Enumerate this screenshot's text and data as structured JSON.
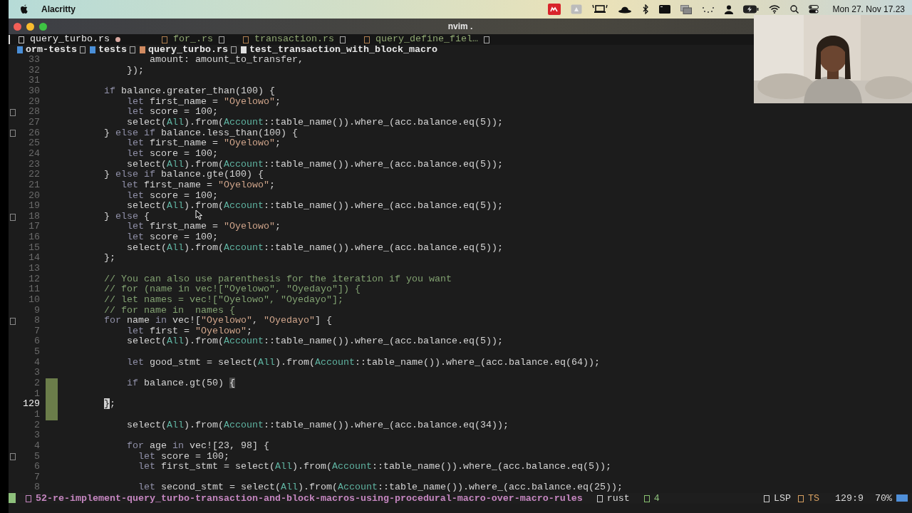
{
  "menu_bar": {
    "app": "Alacritty",
    "clock": "Mon 27. Nov  17.23"
  },
  "window": {
    "title": "nvim ."
  },
  "tabs": [
    {
      "label": "query_turbo.rs",
      "selected": true,
      "modified": true
    },
    {
      "label": "for_.rs",
      "selected": false,
      "modified": false
    },
    {
      "label": "transaction.rs",
      "selected": false,
      "modified": false
    },
    {
      "label": "query_define_fiel…",
      "selected": false,
      "modified": false
    }
  ],
  "breadcrumb": [
    {
      "label": "orm-tests",
      "color": "#4a8fd8"
    },
    {
      "label": "tests",
      "color": "#4a8fd8"
    },
    {
      "label": "query_turbo.rs",
      "color": "#d08a60"
    },
    {
      "label": "test_transaction_with_block_macro",
      "color": "#e0e0e0"
    }
  ],
  "lines": [
    {
      "number": "33",
      "current": false,
      "sign": false,
      "changed": false,
      "segments": [
        {
          "text": "                amount: amount_to_transfer,",
          "kind": "plain"
        }
      ]
    },
    {
      "number": "32",
      "current": false,
      "sign": false,
      "changed": false,
      "segments": [
        {
          "text": "            });",
          "kind": "plain"
        }
      ]
    },
    {
      "number": "31",
      "current": false,
      "sign": false,
      "changed": false
    },
    {
      "number": "30",
      "current": false,
      "sign": false,
      "changed": false,
      "segments": [
        {
          "text": "        if",
          "kind": "kw"
        },
        {
          "text": " balance.greater_than(100) {",
          "kind": "plain"
        }
      ]
    },
    {
      "number": "29",
      "current": false,
      "sign": false,
      "changed": false,
      "segments": [
        {
          "text": "            let",
          "kind": "kw"
        },
        {
          "text": " first_name = ",
          "kind": "plain"
        },
        {
          "text": "\"Oyelowo\"",
          "kind": "str"
        },
        {
          "text": ";",
          "kind": "plain"
        }
      ]
    },
    {
      "number": "28",
      "current": false,
      "sign": true,
      "changed": false,
      "segments": [
        {
          "text": "            let",
          "kind": "kw"
        },
        {
          "text": " score = 100;",
          "kind": "plain"
        }
      ]
    },
    {
      "number": "27",
      "current": false,
      "sign": false,
      "changed": false,
      "segments": [
        {
          "text": "            select(",
          "kind": "plain"
        },
        {
          "text": "All",
          "kind": "type"
        },
        {
          "text": ").from(",
          "kind": "plain"
        },
        {
          "text": "Account",
          "kind": "type"
        },
        {
          "text": "::table_name()).where_(acc.balance.eq(5));",
          "kind": "plain"
        }
      ]
    },
    {
      "number": "26",
      "current": false,
      "sign": true,
      "changed": false,
      "segments": [
        {
          "text": "        } ",
          "kind": "plain"
        },
        {
          "text": "else if",
          "kind": "kw"
        },
        {
          "text": " balance.less_than(100) {",
          "kind": "plain"
        }
      ]
    },
    {
      "number": "25",
      "current": false,
      "sign": false,
      "changed": false,
      "segments": [
        {
          "text": "            let",
          "kind": "kw"
        },
        {
          "text": " first_name = ",
          "kind": "plain"
        },
        {
          "text": "\"Oyelowo\"",
          "kind": "str"
        },
        {
          "text": ";",
          "kind": "plain"
        }
      ]
    },
    {
      "number": "24",
      "current": false,
      "sign": false,
      "changed": false,
      "segments": [
        {
          "text": "            let",
          "kind": "kw"
        },
        {
          "text": " score = 100;",
          "kind": "plain"
        }
      ]
    },
    {
      "number": "23",
      "current": false,
      "sign": false,
      "changed": false,
      "segments": [
        {
          "text": "            select(",
          "kind": "plain"
        },
        {
          "text": "All",
          "kind": "type"
        },
        {
          "text": ").from(",
          "kind": "plain"
        },
        {
          "text": "Account",
          "kind": "type"
        },
        {
          "text": "::table_name()).where_(acc.balance.eq(5));",
          "kind": "plain"
        }
      ]
    },
    {
      "number": "22",
      "current": false,
      "sign": false,
      "changed": false,
      "segments": [
        {
          "text": "        } ",
          "kind": "plain"
        },
        {
          "text": "else if",
          "kind": "kw"
        },
        {
          "text": " balance.gte(100) {",
          "kind": "plain"
        }
      ]
    },
    {
      "number": "21",
      "current": false,
      "sign": false,
      "changed": false,
      "segments": [
        {
          "text": "           let",
          "kind": "kw"
        },
        {
          "text": " first_name = ",
          "kind": "plain"
        },
        {
          "text": "\"Oyelowo\"",
          "kind": "str"
        },
        {
          "text": ";",
          "kind": "plain"
        }
      ]
    },
    {
      "number": "20",
      "current": false,
      "sign": false,
      "changed": false,
      "segments": [
        {
          "text": "            let",
          "kind": "kw"
        },
        {
          "text": " score = 100;",
          "kind": "plain"
        }
      ]
    },
    {
      "number": "19",
      "current": false,
      "sign": false,
      "changed": false,
      "segments": [
        {
          "text": "            select(",
          "kind": "plain"
        },
        {
          "text": "All",
          "kind": "type"
        },
        {
          "text": ").from(",
          "kind": "plain"
        },
        {
          "text": "Account",
          "kind": "type"
        },
        {
          "text": "::table_name()).where_(acc.balance.eq(5));",
          "kind": "plain"
        }
      ]
    },
    {
      "number": "18",
      "current": false,
      "sign": true,
      "changed": false,
      "segments": [
        {
          "text": "        } ",
          "kind": "plain"
        },
        {
          "text": "else",
          "kind": "kw"
        },
        {
          "text": " {",
          "kind": "plain"
        }
      ]
    },
    {
      "number": "17",
      "current": false,
      "sign": false,
      "changed": false,
      "segments": [
        {
          "text": "            let",
          "kind": "kw"
        },
        {
          "text": " first_name = ",
          "kind": "plain"
        },
        {
          "text": "\"Oyelowo\"",
          "kind": "str"
        },
        {
          "text": ";",
          "kind": "plain"
        }
      ]
    },
    {
      "number": "16",
      "current": false,
      "sign": false,
      "changed": false,
      "segments": [
        {
          "text": "            let",
          "kind": "kw"
        },
        {
          "text": " score = 100;",
          "kind": "plain"
        }
      ]
    },
    {
      "number": "15",
      "current": false,
      "sign": false,
      "changed": false,
      "segments": [
        {
          "text": "            select(",
          "kind": "plain"
        },
        {
          "text": "All",
          "kind": "type"
        },
        {
          "text": ").from(",
          "kind": "plain"
        },
        {
          "text": "Account",
          "kind": "type"
        },
        {
          "text": "::table_name()).where_(acc.balance.eq(5));",
          "kind": "plain"
        }
      ]
    },
    {
      "number": "14",
      "current": false,
      "sign": false,
      "changed": false,
      "segments": [
        {
          "text": "        };",
          "kind": "plain"
        }
      ]
    },
    {
      "number": "13",
      "current": false,
      "sign": false,
      "changed": false
    },
    {
      "number": "12",
      "current": false,
      "sign": false,
      "changed": false,
      "segments": [
        {
          "text": "        // You can also use parenthesis for the iteration if you want",
          "kind": "comment"
        }
      ]
    },
    {
      "number": "11",
      "current": false,
      "sign": false,
      "changed": false,
      "segments": [
        {
          "text": "        // for (name in vec![\"Oyelowo\", \"Oyedayo\"]) {",
          "kind": "comment"
        }
      ]
    },
    {
      "number": "10",
      "current": false,
      "sign": false,
      "changed": false,
      "segments": [
        {
          "text": "        // let names = vec![\"Oyelowo\", \"Oyedayo\"];",
          "kind": "comment"
        }
      ]
    },
    {
      "number": "9",
      "current": false,
      "sign": false,
      "changed": false,
      "segments": [
        {
          "text": "        // for name in  names {",
          "kind": "comment"
        }
      ]
    },
    {
      "number": "8",
      "current": false,
      "sign": true,
      "changed": false,
      "segments": [
        {
          "text": "        for",
          "kind": "kw"
        },
        {
          "text": " name ",
          "kind": "plain"
        },
        {
          "text": "in",
          "kind": "kw"
        },
        {
          "text": " vec![",
          "kind": "plain"
        },
        {
          "text": "\"Oyelowo\"",
          "kind": "str"
        },
        {
          "text": ", ",
          "kind": "plain"
        },
        {
          "text": "\"Oyedayo\"",
          "kind": "str"
        },
        {
          "text": "] {",
          "kind": "plain"
        }
      ]
    },
    {
      "number": "7",
      "current": false,
      "sign": false,
      "changed": false,
      "segments": [
        {
          "text": "            let",
          "kind": "kw"
        },
        {
          "text": " first = ",
          "kind": "plain"
        },
        {
          "text": "\"Oyelowo\"",
          "kind": "str"
        },
        {
          "text": ";",
          "kind": "plain"
        }
      ]
    },
    {
      "number": "6",
      "current": false,
      "sign": false,
      "changed": false,
      "segments": [
        {
          "text": "            select(",
          "kind": "plain"
        },
        {
          "text": "All",
          "kind": "type"
        },
        {
          "text": ").from(",
          "kind": "plain"
        },
        {
          "text": "Account",
          "kind": "type"
        },
        {
          "text": "::table_name()).where_(acc.balance.eq(5));",
          "kind": "plain"
        }
      ]
    },
    {
      "number": "5",
      "current": false,
      "sign": false,
      "changed": false
    },
    {
      "number": "4",
      "current": false,
      "sign": false,
      "changed": false,
      "segments": [
        {
          "text": "            let",
          "kind": "kw"
        },
        {
          "text": " good_stmt = select(",
          "kind": "plain"
        },
        {
          "text": "All",
          "kind": "type"
        },
        {
          "text": ").from(",
          "kind": "plain"
        },
        {
          "text": "Account",
          "kind": "type"
        },
        {
          "text": "::table_name()).where_(acc.balance.eq(64));",
          "kind": "plain"
        }
      ]
    },
    {
      "number": "3",
      "current": false,
      "sign": false,
      "changed": false
    },
    {
      "number": "2",
      "current": false,
      "sign": false,
      "changed": true,
      "segments": [
        {
          "text": "            if",
          "kind": "kw"
        },
        {
          "text": " balance.gt(50) ",
          "kind": "plain"
        },
        {
          "text": "{",
          "kind": "match"
        }
      ]
    },
    {
      "number": "1",
      "current": false,
      "sign": false,
      "changed": true
    },
    {
      "number": "129",
      "current": true,
      "sign": false,
      "changed": true,
      "segments": [
        {
          "text": "        }",
          "kind": "cursor"
        },
        {
          "text": ";",
          "kind": "plain"
        }
      ]
    },
    {
      "number": "1",
      "current": false,
      "sign": false,
      "changed": true
    },
    {
      "number": "2",
      "current": false,
      "sign": false,
      "changed": false,
      "segments": [
        {
          "text": "            select(",
          "kind": "plain"
        },
        {
          "text": "All",
          "kind": "type"
        },
        {
          "text": ").from(",
          "kind": "plain"
        },
        {
          "text": "Account",
          "kind": "type"
        },
        {
          "text": "::table_name()).where_(acc.balance.eq(34));",
          "kind": "plain"
        }
      ]
    },
    {
      "number": "3",
      "current": false,
      "sign": false,
      "changed": false
    },
    {
      "number": "4",
      "current": false,
      "sign": false,
      "changed": false,
      "segments": [
        {
          "text": "            for",
          "kind": "kw"
        },
        {
          "text": " age ",
          "kind": "plain"
        },
        {
          "text": "in",
          "kind": "kw"
        },
        {
          "text": " vec![23, 98] {",
          "kind": "plain"
        }
      ]
    },
    {
      "number": "5",
      "current": false,
      "sign": true,
      "changed": false,
      "segments": [
        {
          "text": "              let",
          "kind": "kw"
        },
        {
          "text": " score = 100;",
          "kind": "plain"
        }
      ]
    },
    {
      "number": "6",
      "current": false,
      "sign": false,
      "changed": false,
      "segments": [
        {
          "text": "              let",
          "kind": "kw"
        },
        {
          "text": " first_stmt = select(",
          "kind": "plain"
        },
        {
          "text": "All",
          "kind": "type"
        },
        {
          "text": ").from(",
          "kind": "plain"
        },
        {
          "text": "Account",
          "kind": "type"
        },
        {
          "text": "::table_name()).where_(acc.balance.eq(5));",
          "kind": "plain"
        }
      ]
    },
    {
      "number": "7",
      "current": false,
      "sign": false,
      "changed": false
    },
    {
      "number": "8",
      "current": false,
      "sign": false,
      "changed": false,
      "segments": [
        {
          "text": "              let",
          "kind": "kw"
        },
        {
          "text": " second_stmt = select(",
          "kind": "plain"
        },
        {
          "text": "All",
          "kind": "type"
        },
        {
          "text": ").from(",
          "kind": "plain"
        },
        {
          "text": "Account",
          "kind": "type"
        },
        {
          "text": "::table_name()).where_(acc.balance.eq(25));",
          "kind": "plain"
        }
      ]
    }
  ],
  "status_bar": {
    "branch": "52-re-implement-query_turbo-transaction-and-block-macros-using-procedural-macro-over-macro-rules",
    "filetype": "rust",
    "diagnostics": "4",
    "lsp": "LSP",
    "ts": "TS",
    "position": "129:9",
    "percent": "70%"
  }
}
